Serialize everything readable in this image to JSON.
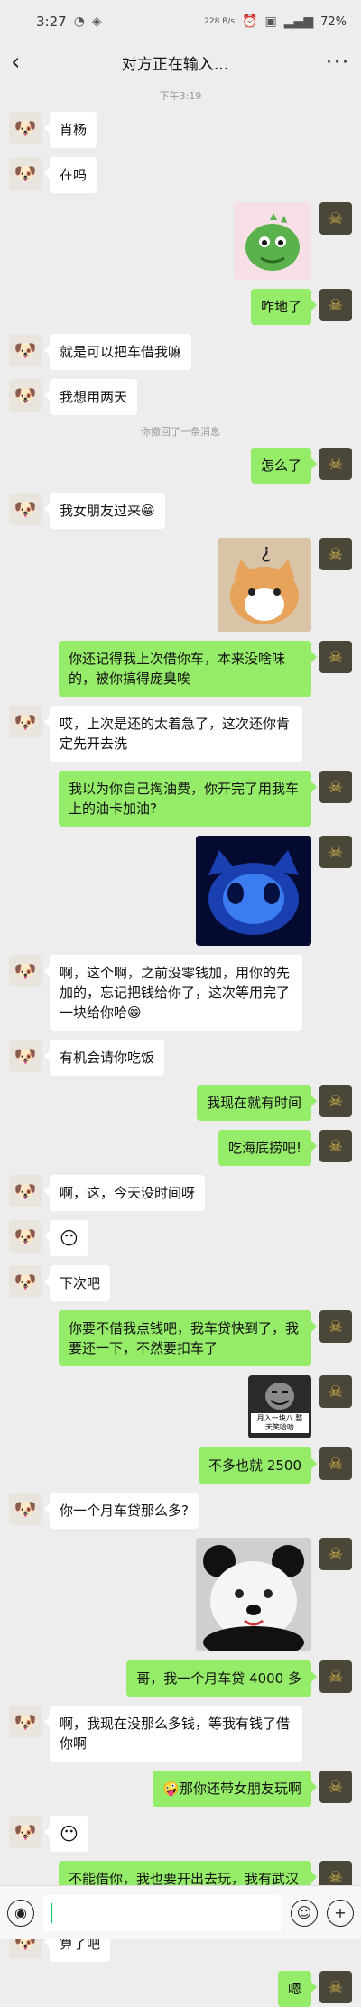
{
  "status_bar": {
    "time": "3:27",
    "net_speed": "228 B/s",
    "battery": "72%"
  },
  "header": {
    "title": "对方正在输入...",
    "back_icon": "chevron-left-icon",
    "more_icon": "more-icon"
  },
  "chat": {
    "timestamp": "下午3:19",
    "recall_notice": "你撤回了一条消息",
    "messages": [
      {
        "from": "them",
        "text": "肖杨"
      },
      {
        "from": "them",
        "text": "在吗"
      },
      {
        "from": "me",
        "type": "sticker",
        "sticker": "green-dinosaur"
      },
      {
        "from": "me",
        "text": "咋地了"
      },
      {
        "from": "them",
        "text": "就是可以把车借我嘛"
      },
      {
        "from": "them",
        "text": "我想用两天"
      },
      {
        "from": "me",
        "text": "怎么了"
      },
      {
        "from": "them",
        "text": "我女朋友过来😁"
      },
      {
        "from": "me",
        "type": "sticker",
        "sticker": "confused-cat"
      },
      {
        "from": "me",
        "text": "你还记得我上次借你车，本来没啥味的，被你搞得庞臭唉"
      },
      {
        "from": "them",
        "text": "哎，上次是还的太着急了，这次还你肯定先开去洗"
      },
      {
        "from": "me",
        "text": "我以为你自己掏油费，你开完了用我车上的油卡加油?"
      },
      {
        "from": "me",
        "type": "sticker",
        "sticker": "blue-glowing-cat"
      },
      {
        "from": "them",
        "text": "啊，这个啊，之前没零钱加，用你的先加的，忘记把钱给你了，这次等用完了一块给你哈😁"
      },
      {
        "from": "them",
        "text": "有机会请你吃饭"
      },
      {
        "from": "me",
        "text": "我现在就有时间"
      },
      {
        "from": "me",
        "text": "吃海底捞吧!"
      },
      {
        "from": "them",
        "text": "啊，这，今天没时间呀"
      },
      {
        "from": "them",
        "text": "😶"
      },
      {
        "from": "them",
        "text": "下次吧"
      },
      {
        "from": "me",
        "text": "你要不借我点钱吧，我车贷快到了，我要还一下，不然要扣车了"
      },
      {
        "from": "me",
        "type": "sticker",
        "sticker": "meme-face",
        "caption": "月入一块八 整天笑哈哈"
      },
      {
        "from": "me",
        "text": "不多也就 2500"
      },
      {
        "from": "them",
        "text": "你一个月车贷那么多?"
      },
      {
        "from": "me",
        "type": "sticker",
        "sticker": "panda-dog"
      },
      {
        "from": "me",
        "text": "哥，我一个月车贷 4000 多"
      },
      {
        "from": "them",
        "text": "啊，我现在没那么多钱，等我有钱了借你啊"
      },
      {
        "from": "me",
        "text": "🤪那你还带女朋友玩啊"
      },
      {
        "from": "them",
        "text": "😶"
      },
      {
        "from": "me",
        "text": "不能借你，我也要开出去玩，我有武汉通的卡，借你吧，坐公交打折的"
      },
      {
        "from": "them",
        "text": "算了吧"
      },
      {
        "from": "me",
        "text": "嗯"
      }
    ]
  },
  "input_bar": {
    "voice_icon": "voice-icon",
    "emoji_icon": "emoji-icon",
    "plus_icon": "plus-icon"
  }
}
